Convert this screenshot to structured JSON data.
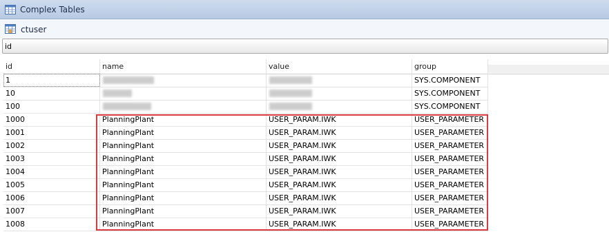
{
  "window": {
    "title": "Complex Tables",
    "title_icon": "table-icon"
  },
  "table_name": {
    "label": "ctuser",
    "icon": "table-icon"
  },
  "filter": {
    "value": "id"
  },
  "columns": [
    "id",
    "name",
    "value",
    "group"
  ],
  "rows": [
    {
      "id": "1",
      "name": "",
      "value": "",
      "group": "SYS.COMPONENT",
      "redacted": true
    },
    {
      "id": "10",
      "name": "",
      "value": "",
      "group": "SYS.COMPONENT",
      "redacted": true
    },
    {
      "id": "100",
      "name": "",
      "value": "",
      "group": "SYS.COMPONENT",
      "redacted": true
    },
    {
      "id": "1000",
      "name": "PlanningPlant",
      "value": "USER_PARAM.IWK",
      "group": "USER_PARAMETER"
    },
    {
      "id": "1001",
      "name": "PlanningPlant",
      "value": "USER_PARAM.IWK",
      "group": "USER_PARAMETER"
    },
    {
      "id": "1002",
      "name": "PlanningPlant",
      "value": "USER_PARAM.IWK",
      "group": "USER_PARAMETER"
    },
    {
      "id": "1003",
      "name": "PlanningPlant",
      "value": "USER_PARAM.IWK",
      "group": "USER_PARAMETER"
    },
    {
      "id": "1004",
      "name": "PlanningPlant",
      "value": "USER_PARAM.IWK",
      "group": "USER_PARAMETER"
    },
    {
      "id": "1005",
      "name": "PlanningPlant",
      "value": "USER_PARAM.IWK",
      "group": "USER_PARAMETER"
    },
    {
      "id": "1006",
      "name": "PlanningPlant",
      "value": "USER_PARAM.IWK",
      "group": "USER_PARAMETER"
    },
    {
      "id": "1007",
      "name": "PlanningPlant",
      "value": "USER_PARAM.IWK",
      "group": "USER_PARAMETER"
    },
    {
      "id": "1008",
      "name": "PlanningPlant",
      "value": "USER_PARAM.IWK",
      "group": "USER_PARAMETER"
    }
  ],
  "highlight_color": "#d9393f"
}
